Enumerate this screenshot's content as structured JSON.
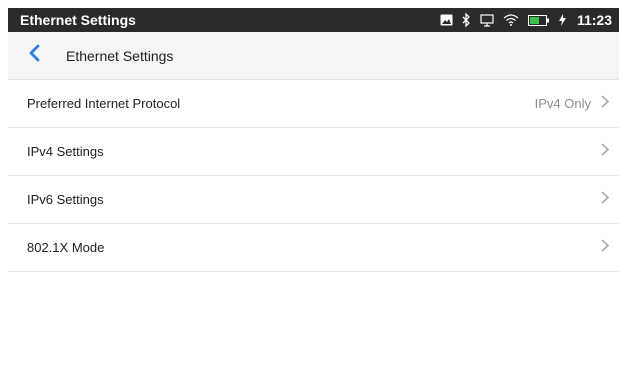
{
  "status_bar": {
    "app_title": "Ethernet Settings",
    "time": "11:23",
    "battery_level": "48%",
    "icons": [
      "image-icon",
      "bluetooth-icon",
      "cast-icon",
      "wifi-icon",
      "battery-icon",
      "charging-icon"
    ]
  },
  "app_bar": {
    "title": "Ethernet Settings",
    "back_icon": "back-arrow-icon",
    "accent_color": "#2a7de1"
  },
  "settings": [
    {
      "label": "Preferred Internet Protocol",
      "value": "IPv4 Only"
    },
    {
      "label": "IPv4 Settings",
      "value": ""
    },
    {
      "label": "IPv6 Settings",
      "value": ""
    },
    {
      "label": "802.1X Mode",
      "value": ""
    }
  ]
}
